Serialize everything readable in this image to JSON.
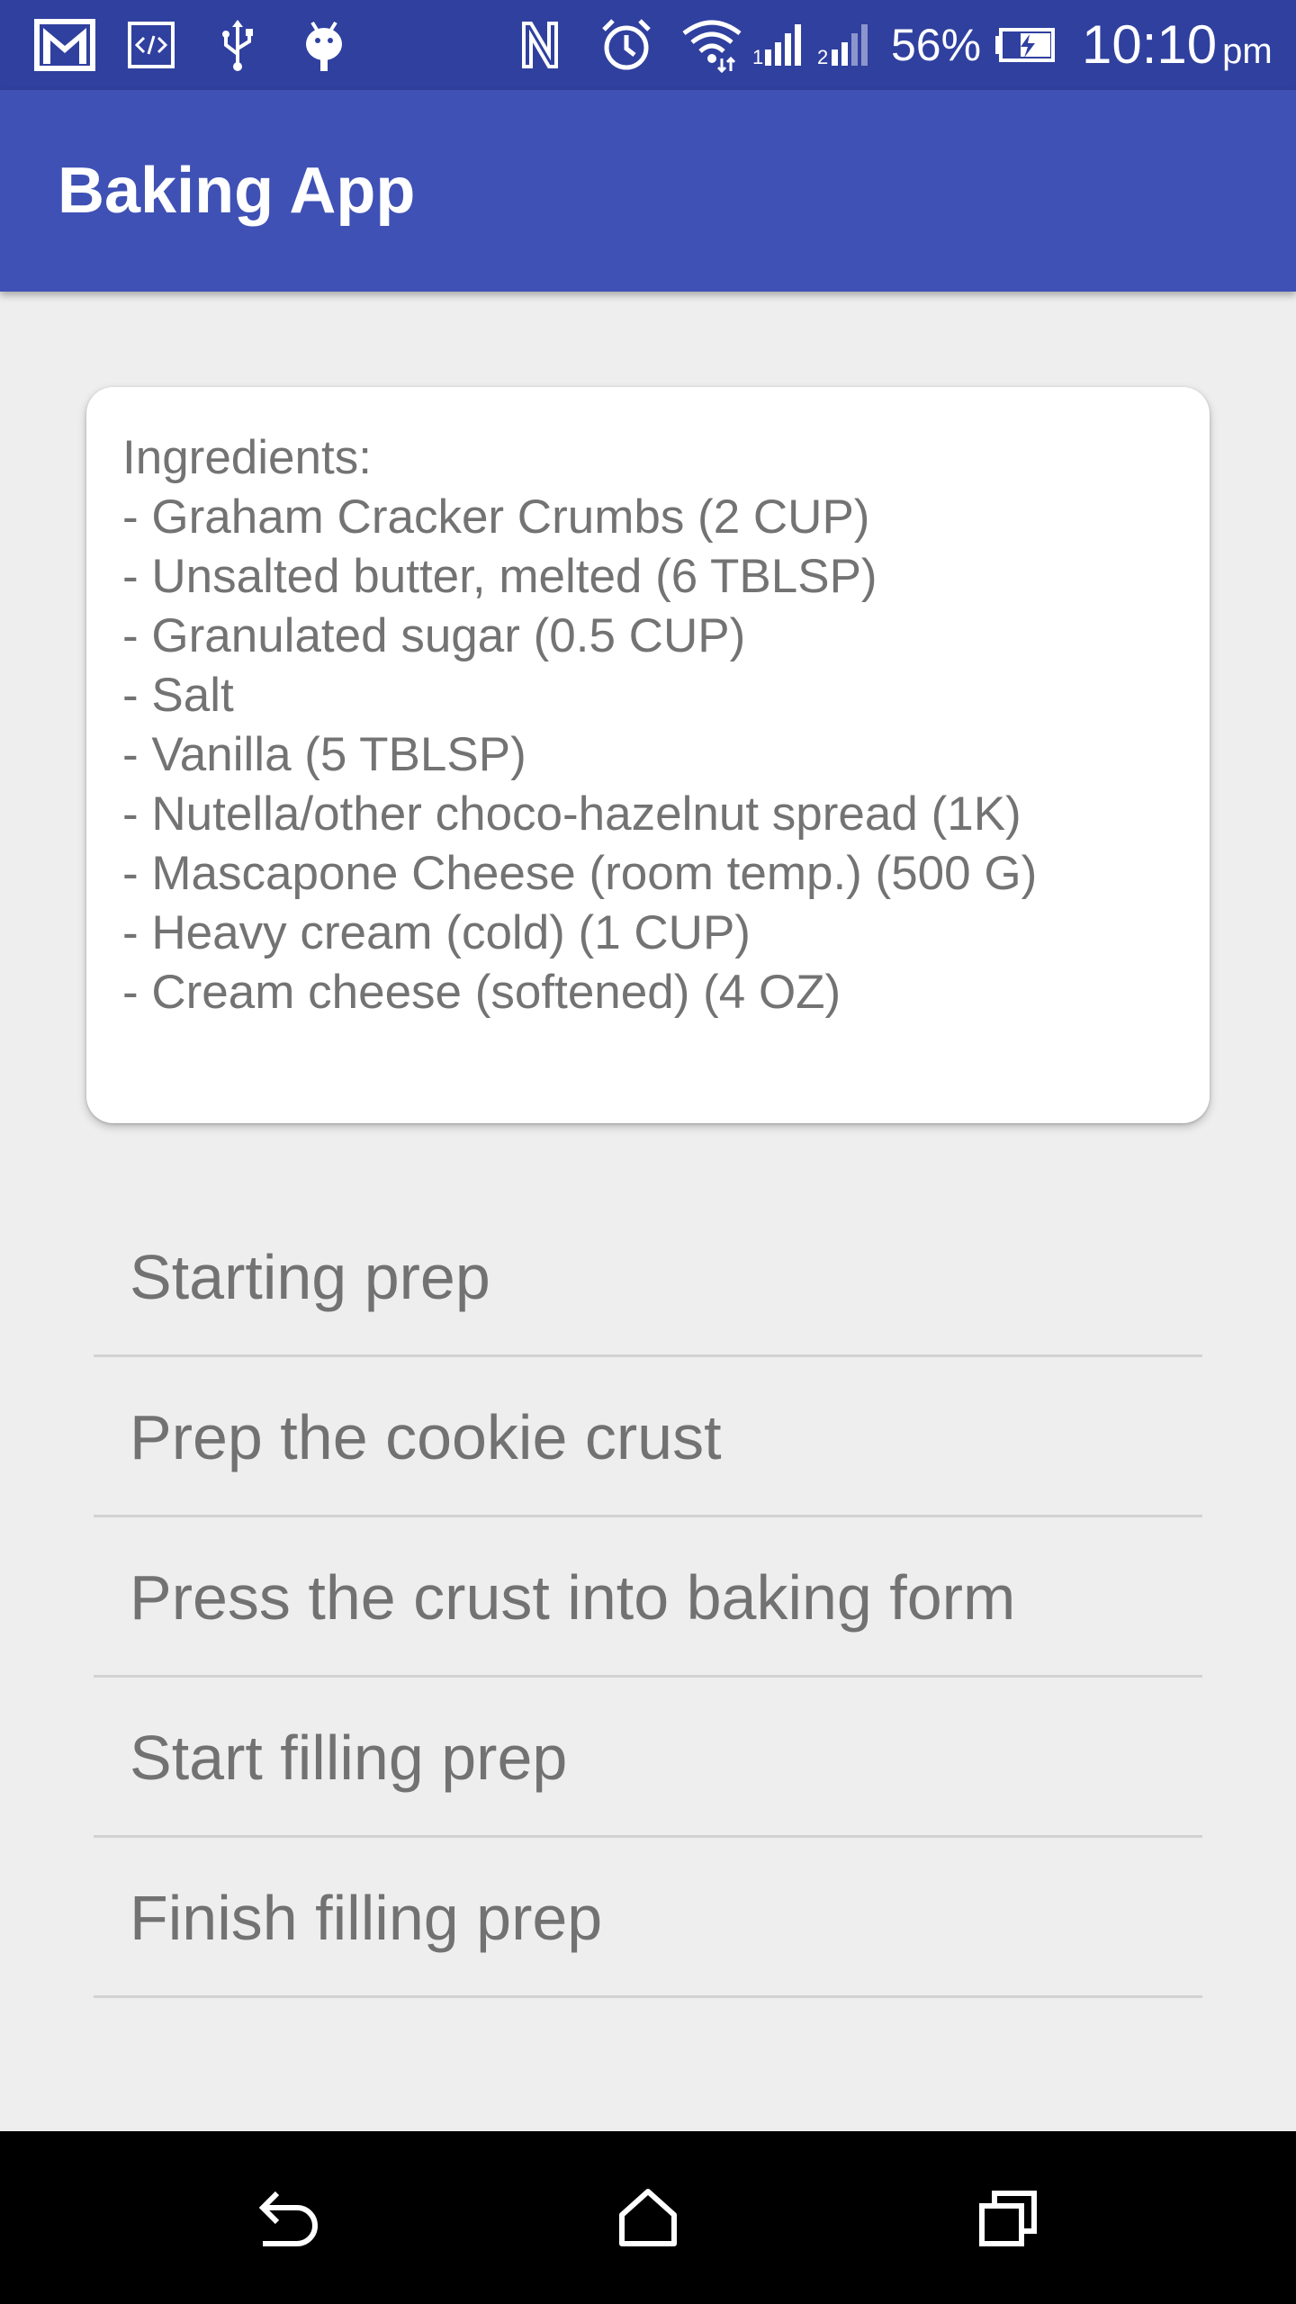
{
  "status_bar": {
    "battery_percent": "56%",
    "time": "10:10",
    "ampm": "pm",
    "icons": [
      "gmail-icon",
      "code-icon",
      "usb-icon",
      "android-debug-icon",
      "nfc-icon",
      "alarm-icon",
      "wifi-icon",
      "signal-icon",
      "signal-secondary-icon",
      "battery-charging-icon"
    ]
  },
  "app_bar": {
    "title": "Baking App",
    "color": "#3f51b5",
    "status_color": "#30409f"
  },
  "ingredients": {
    "lines": [
      "Ingredients:",
      "- Graham Cracker Crumbs (2 CUP)",
      "- Unsalted butter, melted (6 TBLSP)",
      "- Granulated sugar (0.5 CUP)",
      "- Salt",
      "- Vanilla (5 TBLSP)",
      "- Nutella/other choco-hazelnut spread (1K)",
      "- Mascapone Cheese (room temp.) (500 G)",
      "- Heavy cream (cold) (1 CUP)",
      "- Cream cheese (softened) (4 OZ)"
    ]
  },
  "steps": [
    {
      "label": "Starting prep"
    },
    {
      "label": "Prep the cookie crust"
    },
    {
      "label": "Press the crust into baking form"
    },
    {
      "label": "Start filling prep"
    },
    {
      "label": "Finish filling prep"
    }
  ],
  "nav_bar": {
    "buttons": [
      "back-icon",
      "home-icon",
      "recents-icon"
    ]
  }
}
